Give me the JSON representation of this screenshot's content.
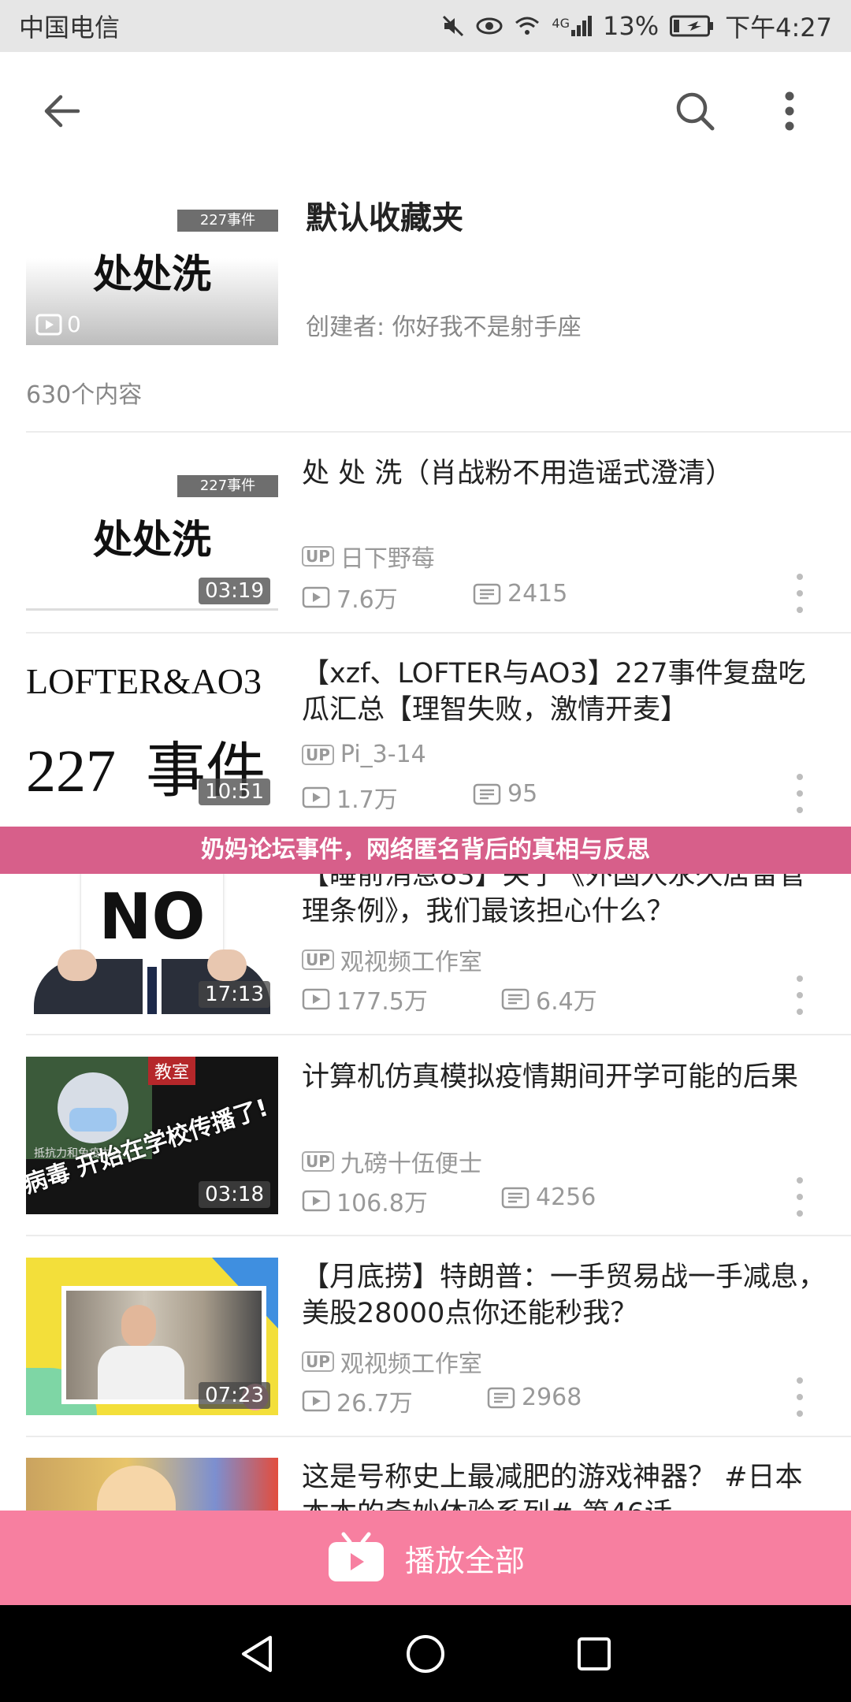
{
  "status_bar": {
    "carrier": "中国电信",
    "network": "4G",
    "battery": "13%",
    "time": "下午4:27"
  },
  "toolbar": {
    "back_icon": "arrow-left-icon",
    "search_icon": "search-icon",
    "more_icon": "more-vertical-icon"
  },
  "favorite": {
    "thumb_text": "处处洗",
    "thumb_badge": "227事件",
    "thumb_count": "0",
    "title": "默认收藏夹",
    "creator": "创建者: 你好我不是射手座",
    "content_count": "630个内容"
  },
  "items": [
    {
      "title": "处 处 洗（肖战粉不用造谣式澄清）",
      "thumb_text": "处处洗",
      "thumb_badge": "227事件",
      "duration": "03:19",
      "up_label": "UP",
      "uploader": "日下野莓",
      "plays": "7.6万",
      "danmaku": "2415"
    },
    {
      "title": "【xzf、LOFTER与AO3】227事件复盘吃瓜汇总【理智失败，激情开麦】",
      "thumb_line1": "LOFTER&AO3",
      "thumb_line2": "227  事件",
      "duration": "10:51",
      "up_label": "UP",
      "uploader": "Pi_3-14",
      "plays": "1.7万",
      "danmaku": "95"
    },
    {
      "title": "【睡前消息83】关于《外国人永久居留管理条例》，我们最该担心什么？",
      "thumb_text": "NO",
      "duration": "17:13",
      "up_label": "UP",
      "uploader": "观视频工作室",
      "plays": "177.5万",
      "danmaku": "6.4万"
    },
    {
      "title": "计算机仿真模拟疫情期间开学可能的后果",
      "thumb_text_1": "教室",
      "thumb_text_2": "病毒 开始在学校传播了!",
      "thumb_text_3": "抵抗力和免疫力人",
      "duration": "03:18",
      "up_label": "UP",
      "uploader": "九磅十伍便士",
      "plays": "106.8万",
      "danmaku": "4256"
    },
    {
      "title": "【月底捞】特朗普：一手贸易战一手减息，美股28000点你还能秒我？",
      "duration": "07:23",
      "up_label": "UP",
      "uploader": "观视频工作室",
      "plays": "26.7万",
      "danmaku": "2968"
    },
    {
      "title": "这是号称史上最减肥的游戏神器？ #日本本本的奇妙体验系列# 第46话"
    }
  ],
  "banner": "奶妈论坛事件，网络匿名背后的真相与反思",
  "play_all": {
    "label": "播放全部",
    "icon": "tv-play-icon"
  },
  "nav_bar": {
    "back": "triangle-back-icon",
    "home": "circle-home-icon",
    "recents": "square-recents-icon"
  }
}
